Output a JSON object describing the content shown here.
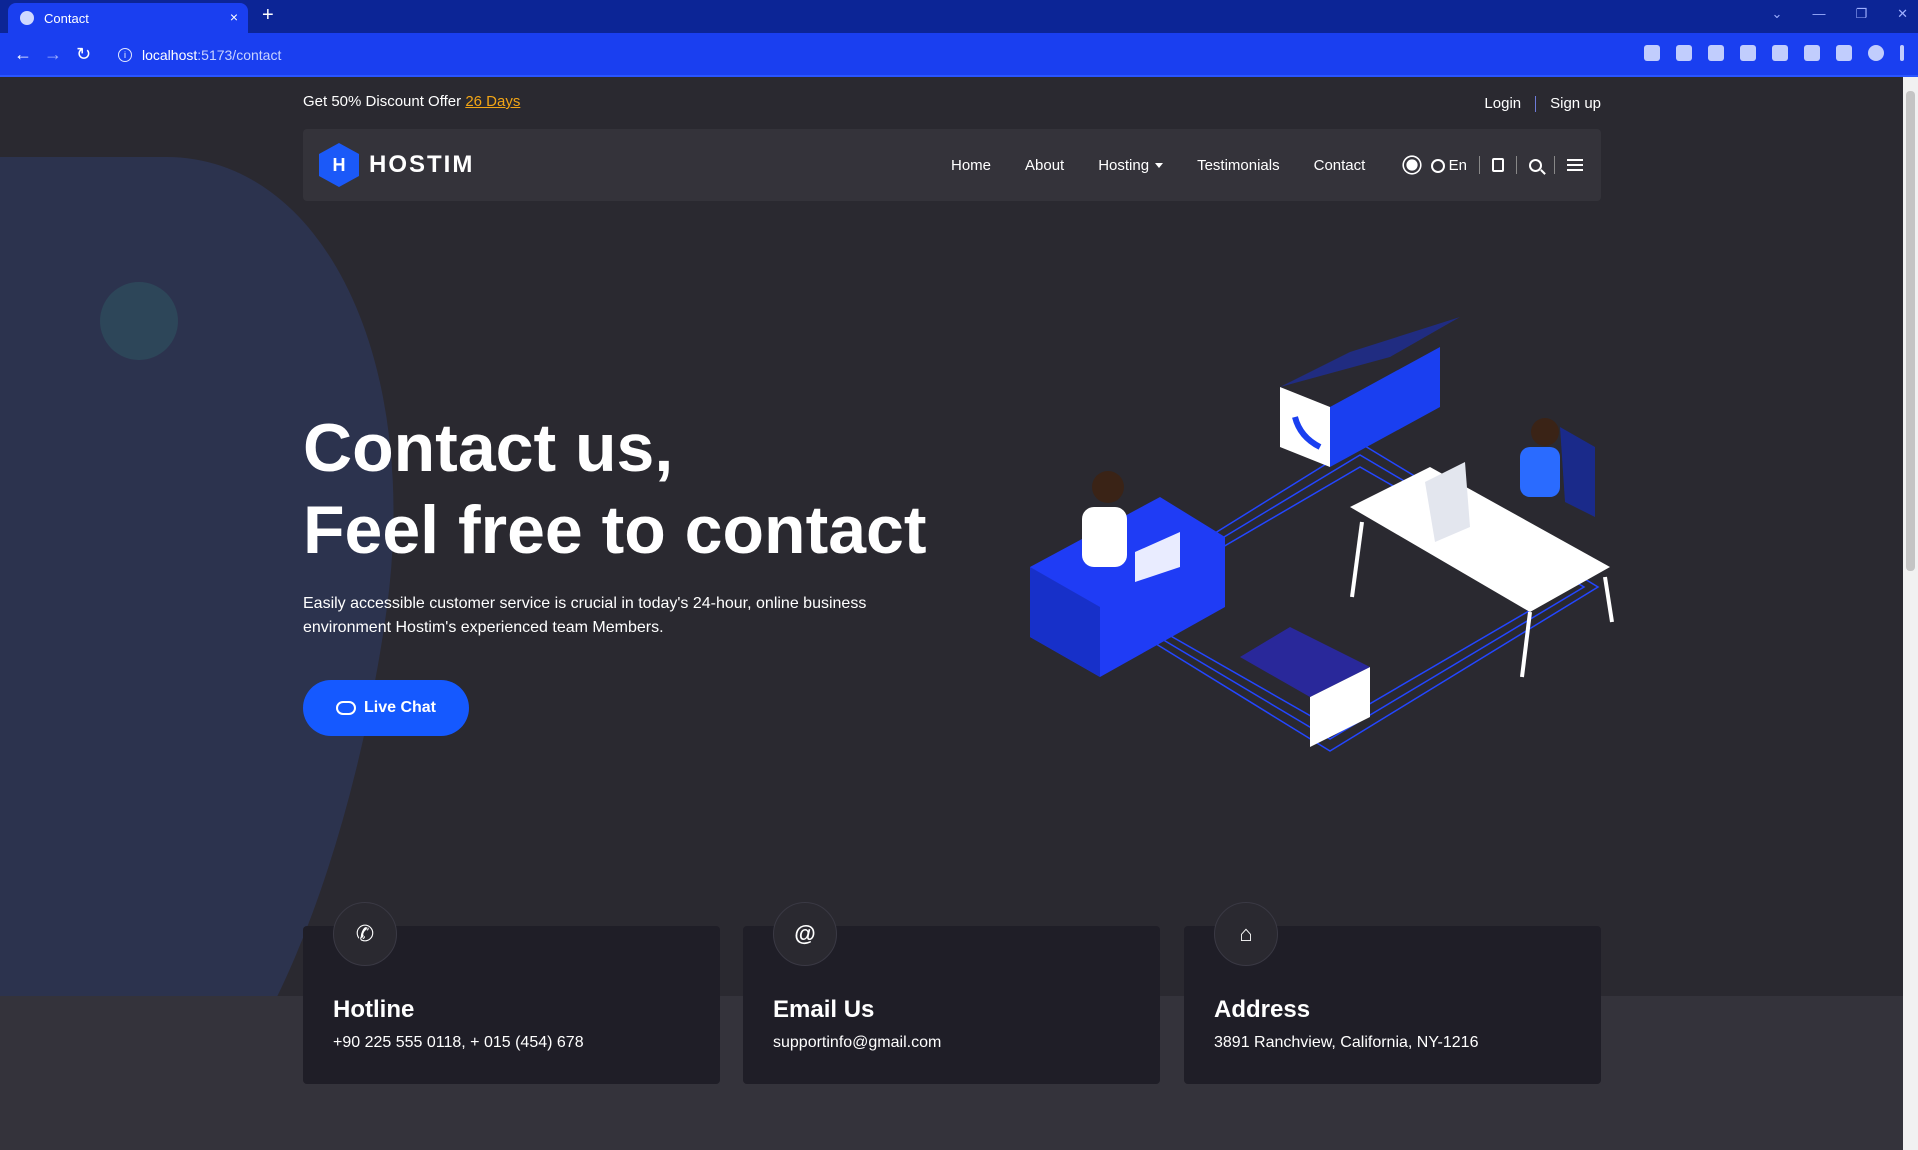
{
  "browser": {
    "tab_title": "Contact",
    "url_host": "localhost",
    "url_path": ":5173/contact",
    "new_tab": "+",
    "close": "×"
  },
  "topbar": {
    "offer_text": "Get 50% Discount Offer ",
    "offer_link": "26 Days",
    "login": "Login",
    "signup": "Sign up"
  },
  "nav": {
    "logo_text": "HOSTIM",
    "logo_mark": "H",
    "items": [
      "Home",
      "About",
      "Hosting",
      "Testimonials",
      "Contact"
    ],
    "language": "En"
  },
  "hero": {
    "title_line1": "Contact us,",
    "title_line2": "Feel free to contact",
    "description": "Easily accessible customer service is crucial in today's 24-hour, online business environment Hostim's experienced team Members.",
    "cta": "Live Chat"
  },
  "contact_cards": [
    {
      "icon": "phone-icon",
      "glyph": "✆",
      "title": "Hotline",
      "text": "+90 225 555 0118, + 015 (454) 678"
    },
    {
      "icon": "at-icon",
      "glyph": "@",
      "title": "Email Us",
      "text": "supportinfo@gmail.com"
    },
    {
      "icon": "home-icon",
      "glyph": "⌂",
      "title": "Address",
      "text": "3891 Ranchview, California, NY-1216"
    }
  ],
  "colors": {
    "accent": "#1559ff",
    "offer": "#f2a516",
    "background": "#2a2930",
    "card": "#1f1e27"
  }
}
